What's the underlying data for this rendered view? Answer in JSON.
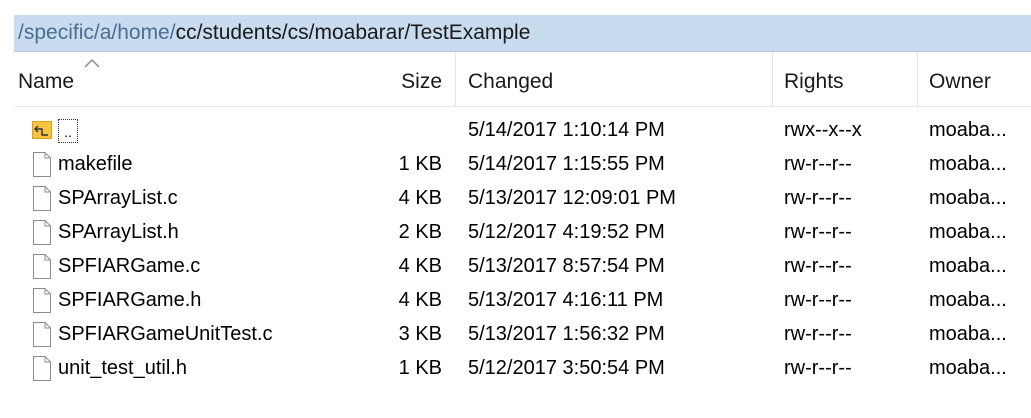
{
  "path": {
    "prefix": "/specific/a/home/",
    "rest": "cc/students/cs/moabarar/TestExample"
  },
  "columns": {
    "name": "Name",
    "size": "Size",
    "changed": "Changed",
    "rights": "Rights",
    "owner": "Owner"
  },
  "rows": [
    {
      "name": "..",
      "size": "",
      "changed": "5/14/2017 1:10:14 PM",
      "rights": "rwx--x--x",
      "owner": "moaba...",
      "icon": "parent-directory-icon"
    },
    {
      "name": "makefile",
      "size": "1 KB",
      "changed": "5/14/2017 1:15:55 PM",
      "rights": "rw-r--r--",
      "owner": "moaba...",
      "icon": "file-icon"
    },
    {
      "name": "SPArrayList.c",
      "size": "4 KB",
      "changed": "5/13/2017 12:09:01 PM",
      "rights": "rw-r--r--",
      "owner": "moaba...",
      "icon": "file-icon"
    },
    {
      "name": "SPArrayList.h",
      "size": "2 KB",
      "changed": "5/12/2017 4:19:52 PM",
      "rights": "rw-r--r--",
      "owner": "moaba...",
      "icon": "file-icon"
    },
    {
      "name": "SPFIARGame.c",
      "size": "4 KB",
      "changed": "5/13/2017 8:57:54 PM",
      "rights": "rw-r--r--",
      "owner": "moaba...",
      "icon": "file-icon"
    },
    {
      "name": "SPFIARGame.h",
      "size": "4 KB",
      "changed": "5/13/2017 4:16:11 PM",
      "rights": "rw-r--r--",
      "owner": "moaba...",
      "icon": "file-icon"
    },
    {
      "name": "SPFIARGameUnitTest.c",
      "size": "3 KB",
      "changed": "5/13/2017 1:56:32 PM",
      "rights": "rw-r--r--",
      "owner": "moaba...",
      "icon": "file-icon"
    },
    {
      "name": "unit_test_util.h",
      "size": "1 KB",
      "changed": "5/12/2017 3:50:54 PM",
      "rights": "rw-r--r--",
      "owner": "moaba...",
      "icon": "file-icon"
    }
  ],
  "colors": {
    "path_bar_bg": "#c9dcef",
    "path_prefix": "#4a6f94",
    "updir_folder": "#f6c343"
  },
  "sort": {
    "column": "name",
    "direction": "ascending"
  }
}
